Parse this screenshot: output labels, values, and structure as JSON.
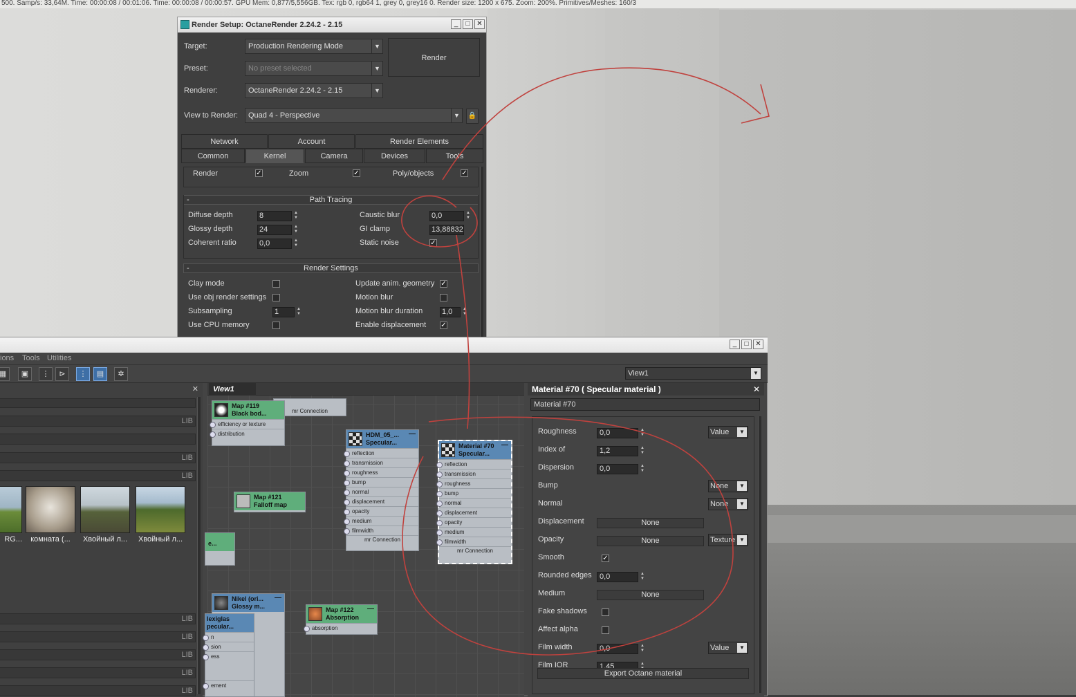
{
  "statusbar": {
    "text": "500. Samp/s: 33,64M. Time: 00:00:08 / 00:01:06. Time: 00:00:08 / 00:00:57. GPU Mem: 0,877/5,556GB. Tex: rgb 0, rgb64 1, grey 0, grey16 0. Render size: 1200 x 675. Zoom: 200%. Primitives/Meshes: 160/3"
  },
  "render_setup": {
    "title": "Render Setup: OctaneRender 2.24.2 - 2.15",
    "window_buttons": [
      "_",
      "□",
      "✕"
    ],
    "target_label": "Target:",
    "target_value": "Production Rendering Mode",
    "preset_label": "Preset:",
    "preset_value": "No preset selected",
    "renderer_label": "Renderer:",
    "renderer_value": "OctaneRender 2.24.2 - 2.15",
    "view_label": "View to Render:",
    "view_value": "Quad 4 - Perspective",
    "render_button": "Render",
    "tabs_row1": [
      "Network",
      "Account",
      "Render Elements"
    ],
    "tabs_row2": [
      "Common",
      "Kernel",
      "Camera",
      "Devices",
      "Tools"
    ],
    "active_tab": "Kernel",
    "top_row": {
      "render": "Render",
      "zoom": "Zoom",
      "poly": "Poly/objects"
    },
    "path_tracing": {
      "header": "Path Tracing",
      "diffuse_label": "Diffuse depth",
      "diffuse_value": "8",
      "glossy_label": "Glossy depth",
      "glossy_value": "24",
      "coherent_label": "Coherent ratio",
      "coherent_value": "0,0",
      "caustic_label": "Caustic blur",
      "caustic_value": "0,0",
      "giclamp_label": "GI clamp",
      "giclamp_value": "13,88832",
      "static_label": "Static noise",
      "static_checked": true
    },
    "render_settings": {
      "header": "Render Settings",
      "clay_label": "Clay mode",
      "objrender_label": "Use obj render settings",
      "subsampling_label": "Subsampling",
      "subsampling_value": "1",
      "cpumem_label": "Use CPU memory",
      "updanim_label": "Update anim. geometry",
      "motionblur_label": "Motion blur",
      "mbduration_label": "Motion blur duration",
      "mbduration_value": "1,0",
      "displacement_label": "Enable displacement"
    }
  },
  "slate": {
    "menu": [
      "ions",
      "Tools",
      "Utilities"
    ],
    "view_combo": "View1",
    "view_tab": "View1",
    "lib_label": "LIB",
    "thumbnails": [
      "RG...",
      "комната (...",
      "Хвойный л...",
      "Хвойный л..."
    ],
    "nodes": {
      "map119": {
        "title": "Map #119",
        "sub": "Black bod...",
        "slots": [
          "efficiency or texture",
          "distribution"
        ]
      },
      "mrconn_top": "mr Connection",
      "hdm": {
        "title": "HDM_05_...",
        "sub": "Specular...",
        "slots": [
          "reflection",
          "transmission",
          "roughness",
          "bump",
          "normal",
          "displacement",
          "opacity",
          "medium",
          "filmwidth"
        ],
        "footer": "mr Connection"
      },
      "mat70": {
        "title": "Material #70",
        "sub": "Specular...",
        "slots": [
          "reflection",
          "transmission",
          "roughness",
          "bump",
          "normal",
          "displacement",
          "opacity",
          "medium",
          "filmwidth"
        ],
        "footer": "mr Connection"
      },
      "map121": {
        "title": "Map #121",
        "sub": "Falloff map"
      },
      "partial": "e...",
      "nikel": {
        "title": "Nikel (ori...",
        "sub": "Glossy m..."
      },
      "plexi": {
        "title": "lexiglas",
        "sub": "pecular...",
        "slots": [
          "n",
          "sion",
          "ess"
        ],
        "footer": "ement"
      },
      "map122": {
        "title": "Map #122",
        "sub": "Absorption",
        "slots": [
          "absorption"
        ]
      }
    }
  },
  "material": {
    "title": "Material #70  ( Specular material )",
    "name": "Material #70",
    "roughness_label": "Roughness",
    "roughness_value": "0,0",
    "roughness_mode": "Value",
    "ior_label": "Index of",
    "ior_value": "1,2",
    "dispersion_label": "Dispersion",
    "dispersion_value": "0,0",
    "bump_label": "Bump",
    "bump_mode": "None",
    "normal_label": "Normal",
    "normal_mode": "None",
    "displacement_label": "Displacement",
    "displacement_value": "None",
    "opacity_label": "Opacity",
    "opacity_value": "None",
    "opacity_mode": "Texture",
    "smooth_label": "Smooth",
    "rounded_label": "Rounded edges",
    "rounded_value": "0,0",
    "medium_label": "Medium",
    "medium_value": "None",
    "fake_label": "Fake shadows",
    "alpha_label": "Affect alpha",
    "filmwidth_label": "Film width",
    "filmwidth_value": "0,0",
    "filmwidth_mode": "Value",
    "filmior_label": "Film IOR",
    "filmior_value": "1,45",
    "export_label": "Export Octane material"
  },
  "colors": {
    "annotation": "#c0423e",
    "selection": "#3e6fa6",
    "node_green": "#5fae7b",
    "node_blue": "#5a88b4"
  },
  "icons": [
    "close-icon",
    "minimize-icon",
    "maximize-icon",
    "lock-icon",
    "dropdown-arrow-icon",
    "checkmark-icon"
  ]
}
